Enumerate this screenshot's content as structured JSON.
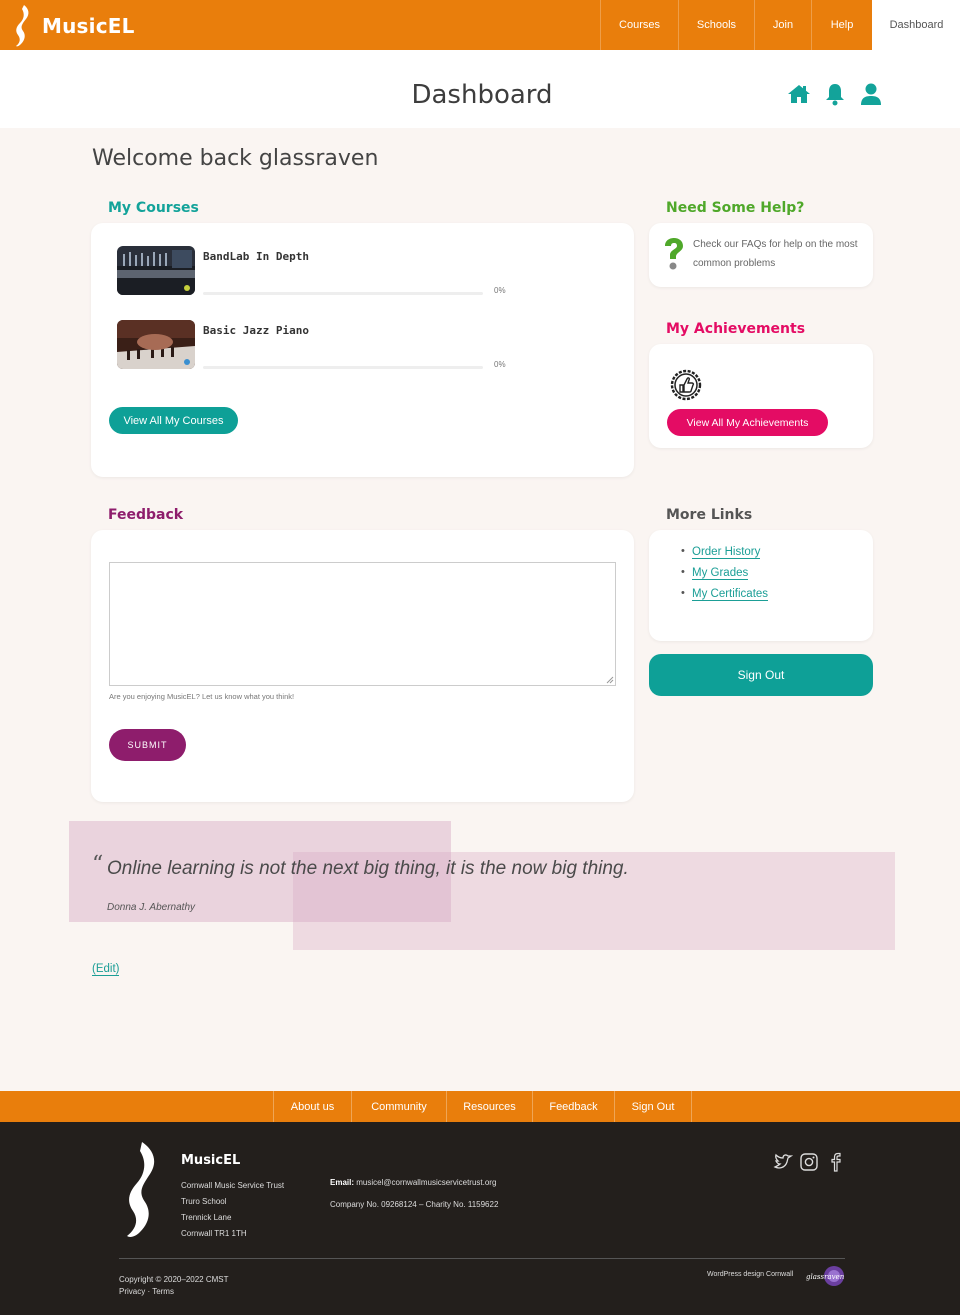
{
  "brand": {
    "name": "MusicEL"
  },
  "nav": {
    "items": [
      {
        "label": "Courses"
      },
      {
        "label": "Schools"
      },
      {
        "label": "Join"
      },
      {
        "label": "Help"
      },
      {
        "label": "Dashboard"
      }
    ]
  },
  "header": {
    "title": "Dashboard",
    "icons": [
      "home-icon",
      "bell-icon",
      "user-icon"
    ]
  },
  "welcome": "Welcome back glassraven",
  "my_courses": {
    "title": "My Courses",
    "courses": [
      {
        "name": "BandLab In Depth",
        "progress": "0%"
      },
      {
        "name": "Basic Jazz Piano",
        "progress": "0%"
      }
    ],
    "button": "View All My Courses"
  },
  "help": {
    "title": "Need Some Help?",
    "text": "Check our FAQs for help on the most common problems"
  },
  "achievements": {
    "title": "My Achievements",
    "button": "View All My Achievements"
  },
  "feedback": {
    "title": "Feedback",
    "hint": "Are you enjoying MusicEL? Let us know what you think!",
    "submit": "SUBMIT"
  },
  "more_links": {
    "title": "More Links",
    "links": [
      "Order History",
      "My Grades",
      "My Certificates"
    ]
  },
  "signout": "Sign Out",
  "quote": {
    "mark": "“",
    "text": "Online learning is not the next big thing, it is the now big thing.",
    "author": "Donna J. Abernathy"
  },
  "edit": "(Edit)",
  "footer_nav": [
    "About us",
    "Community",
    "Resources",
    "Feedback",
    "Sign Out"
  ],
  "footer": {
    "brand": "MusicEL",
    "address": [
      "Cornwall Music Service Trust",
      "Truro School",
      "Trennick Lane",
      "Cornwall TR1 1TH"
    ],
    "email_label": "Email:",
    "email": "musicel@cornwallmusicservicetrust.org",
    "company": "Company No. 09268124 – Charity No. 1159622",
    "copyright": "Copyright © 2020–2022 CMST",
    "legal": "Privacy · Terms",
    "credit": "WordPress design Cornwall",
    "credit_logo": "glassraven",
    "social": [
      "twitter-icon",
      "instagram-icon",
      "facebook-icon"
    ]
  },
  "colors": {
    "orange": "#e97e0c",
    "teal": "#0ea097",
    "pink": "#e40c64",
    "purple": "#8e1d6c",
    "green_title": "#4fa82a"
  }
}
